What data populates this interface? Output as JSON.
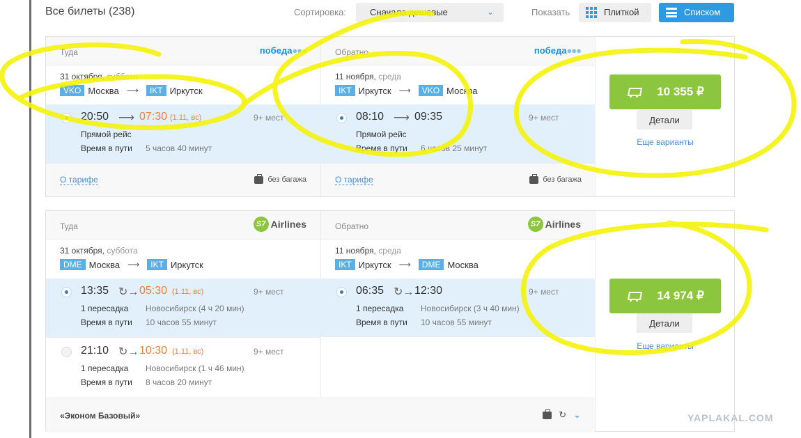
{
  "topbar": {
    "tickets_count": "Все билеты (238)",
    "sort_label": "Сортировка:",
    "sort_value": "Сначала дешевые",
    "show_label": "Показать",
    "tile_label": "Плиткой",
    "list_label": "Списком"
  },
  "cards": [
    {
      "outbound": {
        "direction": "Туда",
        "airline_logo": "победа",
        "date": "31 октября,",
        "weekday": "суббота",
        "from_code": "VKO",
        "from_city": "Москва",
        "to_code": "IKT",
        "to_city": "Иркутск",
        "options": [
          {
            "dep": "20:50",
            "arr": "07:30",
            "next_day": "(1.11, вс)",
            "seats": "9+ мест",
            "line1_label": "Прямой рейс",
            "line1_value": "",
            "duration_label": "Время в пути",
            "duration": "5 часов 40 минут"
          }
        ],
        "tariff_link": "О тарифе",
        "baggage": "без багажа"
      },
      "return": {
        "direction": "Обратно",
        "airline_logo": "победа",
        "date": "11 ноября,",
        "weekday": "среда",
        "from_code": "IKT",
        "from_city": "Иркутск",
        "to_code": "VKO",
        "to_city": "Москва",
        "options": [
          {
            "dep": "08:10",
            "arr": "09:35",
            "next_day": "",
            "seats": "9+ мест",
            "line1_label": "Прямой рейс",
            "line1_value": "",
            "duration_label": "Время в пути",
            "duration": "6 часов 25 минут"
          }
        ],
        "tariff_link": "О тарифе",
        "baggage": "без багажа"
      },
      "price": "10 355 ₽",
      "details": "Детали",
      "more": "Еще варианты"
    },
    {
      "outbound": {
        "direction": "Туда",
        "airline_logo": "Airlines",
        "airline_mark": "S7",
        "date": "31 октября,",
        "weekday": "суббота",
        "from_code": "DME",
        "from_city": "Москва",
        "to_code": "IKT",
        "to_city": "Иркутск",
        "options": [
          {
            "dep": "13:35",
            "arr": "05:30",
            "next_day": "(1.11, вс)",
            "seats": "9+ мест",
            "line1_label": "1 пересадка",
            "line1_value": "Новосибирск (4 ч 20 мин)",
            "duration_label": "Время в пути",
            "duration": "10 часов 55 минут"
          },
          {
            "dep": "21:10",
            "arr": "10:30",
            "next_day": "(1.11, вс)",
            "seats": "9+ мест",
            "line1_label": "1 пересадка",
            "line1_value": "Новосибирск (1 ч 46 мин)",
            "duration_label": "Время в пути",
            "duration": "8 часов 20 минут"
          }
        ]
      },
      "return": {
        "direction": "Обратно",
        "airline_logo": "Airlines",
        "airline_mark": "S7",
        "date": "11 ноября,",
        "weekday": "среда",
        "from_code": "IKT",
        "from_city": "Иркутск",
        "to_code": "DME",
        "to_city": "Москва",
        "options": [
          {
            "dep": "06:35",
            "arr": "12:30",
            "next_day": "",
            "seats": "9+ мест",
            "line1_label": "1 пересадка",
            "line1_value": "Новосибирск (3 ч 40 мин)",
            "duration_label": "Время в пути",
            "duration": "10 часов 55 минут"
          }
        ]
      },
      "fare_name": "«Эконом Базовый»",
      "price": "14 974 ₽",
      "details": "Детали",
      "more": "Еще варианты"
    }
  ],
  "icons": {
    "cart": "cart-icon",
    "baggage": "suitcase-icon",
    "transfer": "transfer-arrow-icon",
    "flight_arrow": "arrow-right-icon",
    "chevron": "chevron-down-icon"
  },
  "colors": {
    "accent_blue": "#2f9ae0",
    "buy_green": "#8cc63f",
    "next_day_orange": "#f0803c",
    "selected_row": "#e2f0fb",
    "marker_yellow": "#f5f20a"
  },
  "watermark": "YAPLAKAL.COM"
}
